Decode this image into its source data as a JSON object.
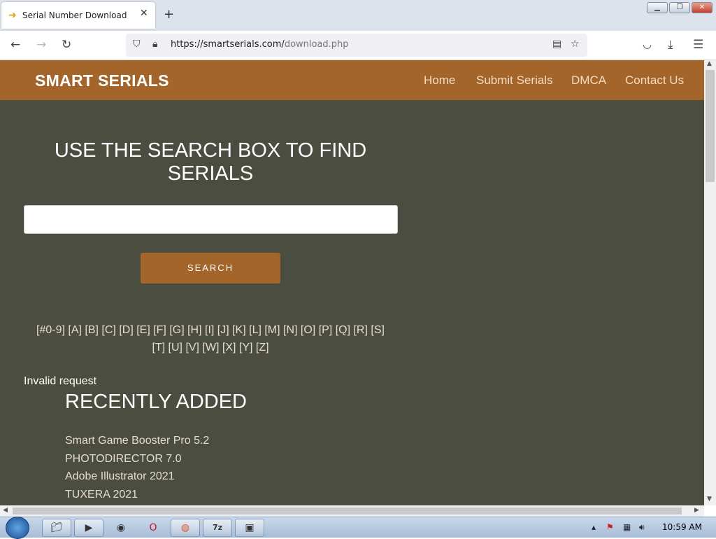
{
  "browser": {
    "tab_title": "Serial Number Download",
    "url_domain": "https://smartserials.com/",
    "url_path": "download.php"
  },
  "site": {
    "logo": "SMART SERIALS",
    "nav": [
      "Home",
      "Submit Serials",
      "DMCA",
      "Contact Us"
    ],
    "heading": "USE THE SEARCH BOX TO FIND SERIALS",
    "search_value": "",
    "search_button": "SEARCH",
    "alpha_line1": "[#0-9] [A] [B] [C] [D] [E] [F] [G] [H] [I] [J] [K] [L] [M] [N] [O] [P] [Q] [R] [S]",
    "alpha_line2": "[T] [U] [V] [W] [X] [Y] [Z]",
    "status": "Invalid request",
    "recent_title": "RECENTLY ADDED",
    "recent": [
      "Smart Game Booster Pro 5.2",
      "PHOTODIRECTOR 7.0",
      "Adobe Illustrator 2021",
      "TUXERA 2021"
    ]
  },
  "taskbar": {
    "clock": "10:59 AM"
  },
  "colors": {
    "header": "#a4652a",
    "background": "#4b4d40",
    "nav_text": "#f1dcc4"
  }
}
